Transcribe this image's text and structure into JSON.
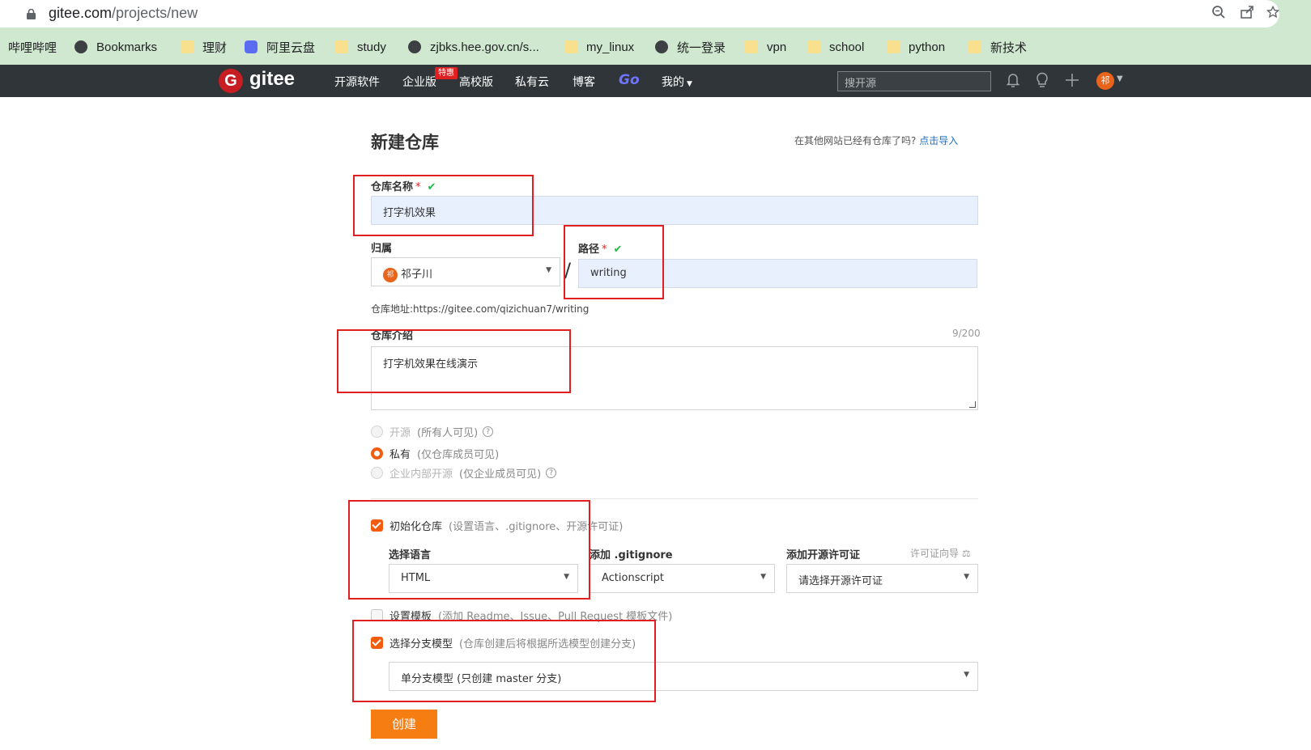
{
  "browser": {
    "url_host": "gitee.com",
    "url_path": "/projects/new",
    "bookmarks": [
      "哔哩哔哩",
      "Bookmarks",
      "理财",
      "阿里云盘",
      "study",
      "zjbks.hee.gov.cn/s...",
      "my_linux",
      "统一登录",
      "vpn",
      "school",
      "python",
      "新技术"
    ]
  },
  "nav": {
    "logo_letter": "G",
    "logo_text": "gitee",
    "items": [
      "开源软件",
      "企业版",
      "高校版",
      "私有云",
      "博客"
    ],
    "go_label": "Go",
    "mine_label": "我的",
    "badge": "特惠",
    "search_placeholder": "搜开源",
    "avatar_text": "祁"
  },
  "form": {
    "title": "新建仓库",
    "import_hint": "在其他网站已经有仓库了吗?",
    "import_link": "点击导入",
    "repo_name_label": "仓库名称",
    "repo_name_value": "打字机效果",
    "owner_label": "归属",
    "owner_value": "祁子川",
    "owner_avatar": "祁",
    "path_label": "路径",
    "path_value": "writing",
    "required_mark": "*",
    "valid_mark": "✔",
    "slash": "/",
    "address_label": "仓库地址:",
    "address_value": "https://gitee.com/qizichuan7/writing",
    "intro_label": "仓库介绍",
    "intro_counter": "9/200",
    "intro_value": "打字机效果在线演示",
    "visibility": [
      {
        "label": "开源",
        "hint": "(所有人可见)",
        "selected": false,
        "disabled": true
      },
      {
        "label": "私有",
        "hint": "(仅仓库成员可见)",
        "selected": true,
        "disabled": false
      },
      {
        "label": "企业内部开源",
        "hint": "(仅企业成员可见)",
        "selected": false,
        "disabled": true
      }
    ],
    "help_glyph": "?",
    "init_label": "初始化仓库",
    "init_hint": "(设置语言、.gitignore、开源许可证)",
    "language_label": "选择语言",
    "language_value": "HTML",
    "gitignore_label": "添加 .gitignore",
    "gitignore_value": "Actionscript",
    "license_label": "添加开源许可证",
    "license_guide": "许可证向导 ⚖",
    "license_value": "请选择开源许可证",
    "template_label": "设置模板",
    "template_hint": "(添加 Readme、Issue、Pull Request 模板文件)",
    "branch_label": "选择分支模型",
    "branch_hint": "(仓库创建后将根据所选模型创建分支)",
    "branch_value": "单分支模型 (只创建 master 分支)",
    "create_button": "创建"
  },
  "colors": {
    "accent": "#f35b0f",
    "create_button": "#f57d12",
    "nav_bg": "#2f3538",
    "input_fill": "#e8f0fe",
    "annotation": "#e02020"
  }
}
